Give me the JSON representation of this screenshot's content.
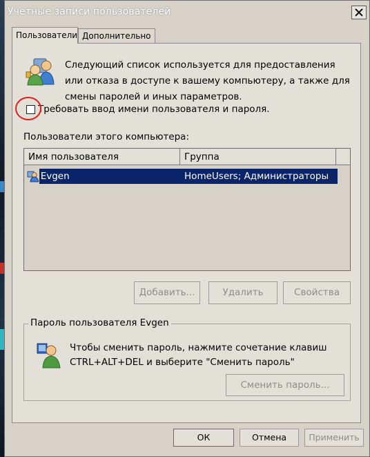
{
  "window": {
    "title": "Учетные записи пользователей"
  },
  "tabs": [
    {
      "label": "Пользователи",
      "active": true
    },
    {
      "label": "Дополнительно",
      "active": false
    }
  ],
  "intro": {
    "text": "Следующий список используется для предоставления или отказа в доступе к вашему компьютеру, а также для смены паролей и иных параметров."
  },
  "require_login": {
    "label": "Требовать ввод имени пользователя и пароля.",
    "checked": false
  },
  "users": {
    "label": "Пользователи этого компьютера:",
    "columns": [
      "Имя пользователя",
      "Группа"
    ],
    "rows": [
      {
        "name": "Evgen",
        "group": "HomeUsers; Администраторы",
        "selected": true
      }
    ],
    "buttons": {
      "add": "Добавить...",
      "remove": "Удалить",
      "properties": "Свойства"
    }
  },
  "password_group": {
    "title": "Пароль пользователя Evgen",
    "text": "Чтобы сменить пароль, нажмите сочетание клавиш CTRL+ALT+DEL и выберите \"Сменить пароль\"",
    "button": "Сменить пароль..."
  },
  "dialog_buttons": {
    "ok": "ОК",
    "cancel": "Отмена",
    "apply": "Применить"
  },
  "colors": {
    "selection": "#0a246a",
    "dialog": "#e3e0d8",
    "highlight_circle": "#e51a1a"
  }
}
